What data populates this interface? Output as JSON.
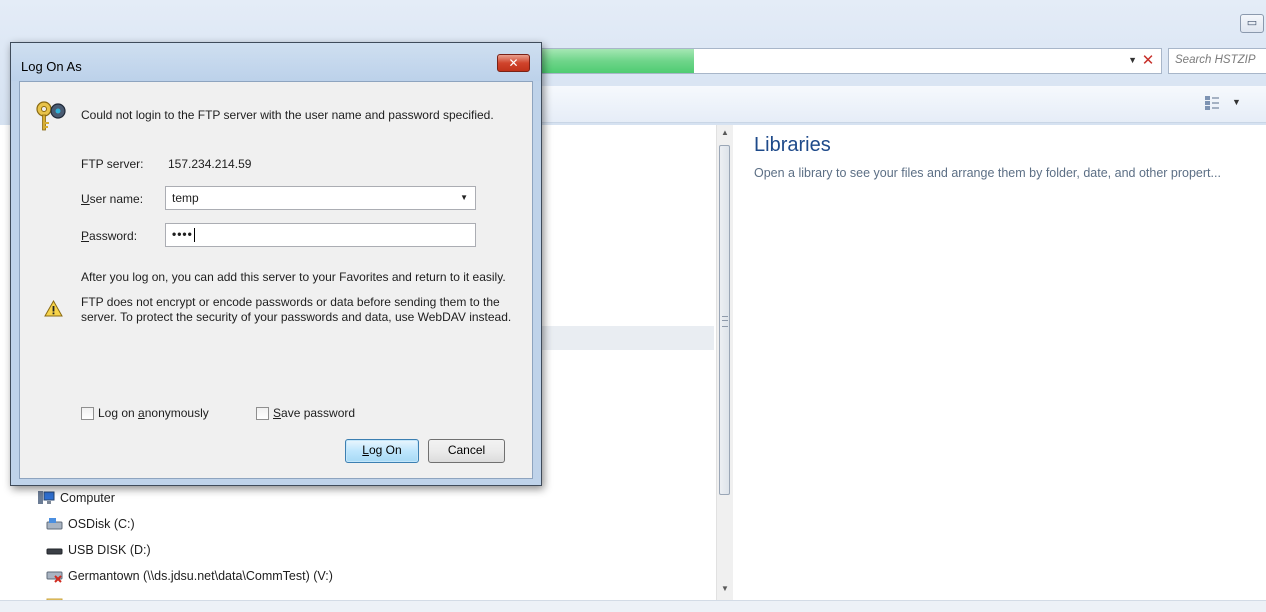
{
  "explorer": {
    "search_placeholder": "Search HSTZIP",
    "nav": {
      "computer": "Computer",
      "osdisk": "OSDisk (C:)",
      "usb": "USB DISK (D:)",
      "germantown": "Germantown (\\\\ds.jdsu.net\\data\\CommTest) (V:)"
    },
    "content": {
      "title": "Libraries",
      "description": "Open a library to see your files and arrange them by folder, date, and other propert..."
    },
    "address_progress": 0.27,
    "colors": {
      "progress": "#4fcc72",
      "libraries_title": "#1e4a8a"
    }
  },
  "dialog": {
    "title": "Log On As",
    "close_icon": "close-x",
    "error_message": "Could not login to the FTP server with the user name and password specified.",
    "ftp_server_label": "FTP server:",
    "ftp_server_value": "157.234.214.59",
    "user_name_label_pre": "",
    "user_name_label_ak": "U",
    "user_name_label_post": "ser name:",
    "user_name_value": "temp",
    "password_label_pre": "",
    "password_label_ak": "P",
    "password_label_post": "assword:",
    "password_value": "••••",
    "info_message": "After you log on, you can add this server to your Favorites and return to it easily.",
    "warning_line1": "FTP does not encrypt or encode passwords or data before sending them to the",
    "warning_line2": "server.  To protect the security of your passwords and data, use WebDAV instead.",
    "anonymous_pre": "Log on ",
    "anonymous_ak": "a",
    "anonymous_post": "nonymously",
    "anonymous_checked": false,
    "save_pre": "",
    "save_ak": "S",
    "save_post": "ave password",
    "save_checked": false,
    "logon_pre": "",
    "logon_ak": "L",
    "logon_post": "og On",
    "cancel_label": "Cancel"
  }
}
